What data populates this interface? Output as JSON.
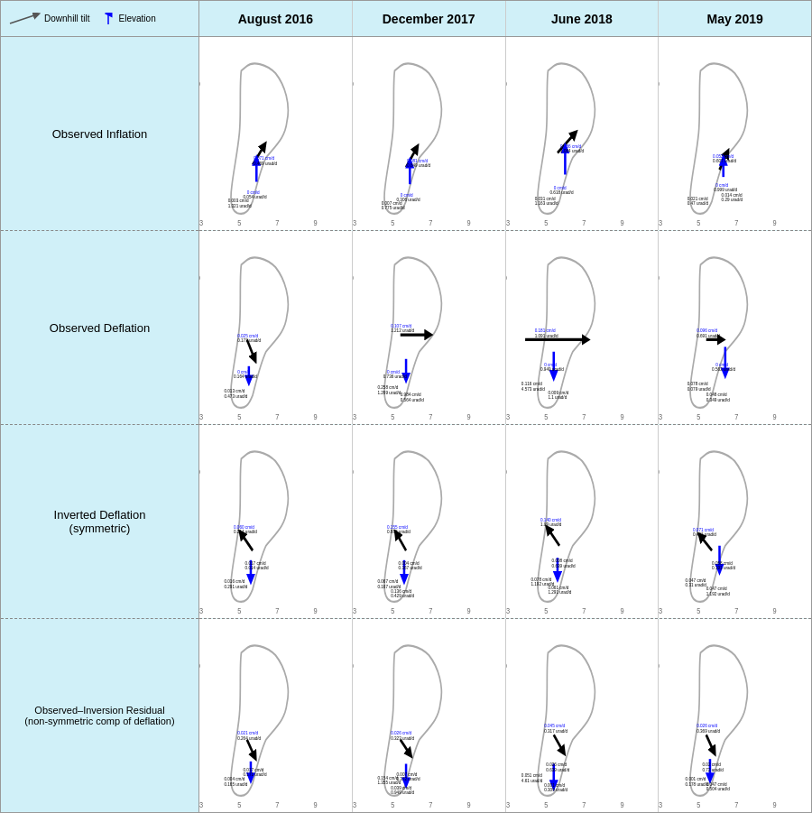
{
  "legend": {
    "downhill_label": "Downhill tilt",
    "elevation_label": "Elevation"
  },
  "col_headers": [
    "August 2016",
    "December 2017",
    "June 2018",
    "May 2019"
  ],
  "row_labels": [
    "Observed Inflation",
    "Observed Deflation",
    "Inverted Deflation\n(symmetric)",
    "Observed–Inversion Residual\n(non-symmetric comp of deflation)"
  ]
}
